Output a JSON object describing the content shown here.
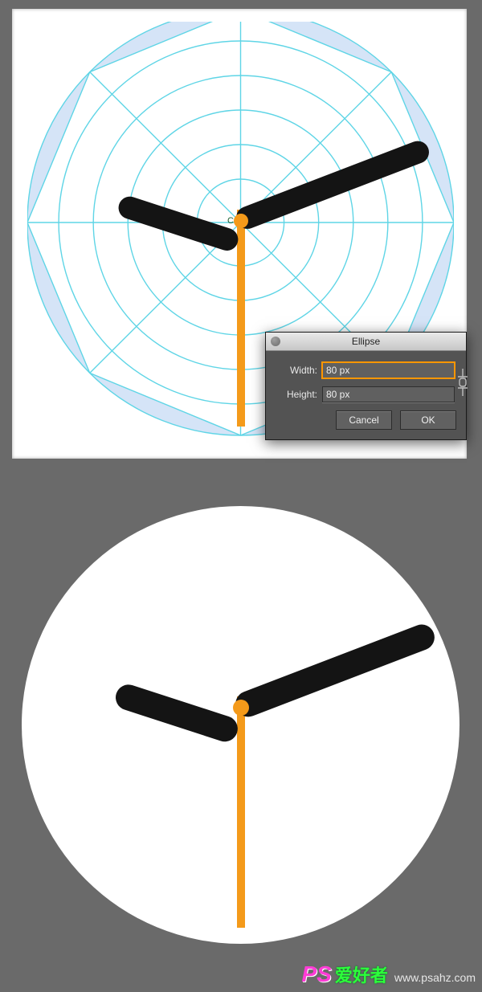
{
  "editor": {
    "center_label": "Center",
    "dialog": {
      "title": "Ellipse",
      "fields": {
        "width_label": "Width:",
        "width_value": "80 px",
        "height_label": "Height:",
        "height_value": "80 px"
      },
      "buttons": {
        "cancel": "Cancel",
        "ok": "OK"
      }
    }
  },
  "watermark": {
    "logo_ps": "PS",
    "logo_cn": "爱好者",
    "url": "www.psahz.com"
  }
}
